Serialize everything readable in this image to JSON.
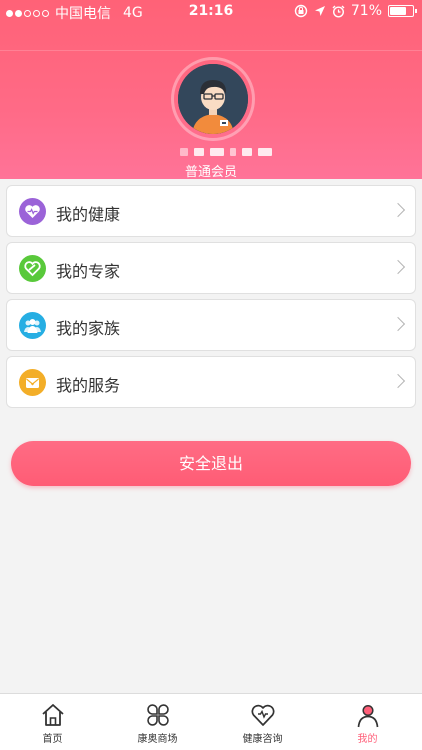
{
  "status_bar": {
    "carrier": "中国电信",
    "network": "4G",
    "time": "21:16",
    "battery_percent": "71%",
    "battery_level": 0.71,
    "signal_bars_filled": 2,
    "signal_bars_total": 5
  },
  "profile": {
    "member_level": "普通会员"
  },
  "menu": {
    "items": [
      {
        "label": "我的健康",
        "icon": "heart-pulse-icon",
        "color": "#9b63d8"
      },
      {
        "label": "我的专家",
        "icon": "expert-heart-icon",
        "color": "#59c93b"
      },
      {
        "label": "我的家族",
        "icon": "family-icon",
        "color": "#26aee3"
      },
      {
        "label": "我的服务",
        "icon": "service-envelope-icon",
        "color": "#f3ae28"
      }
    ]
  },
  "logout": {
    "label": "安全退出"
  },
  "tabbar": {
    "items": [
      {
        "label": "首页",
        "icon": "home-icon"
      },
      {
        "label": "康奥商场",
        "icon": "mall-clover-icon"
      },
      {
        "label": "健康咨询",
        "icon": "consult-heart-icon"
      },
      {
        "label": "我的",
        "icon": "profile-icon"
      }
    ],
    "active_index": 3,
    "active_color": "#ff5f79"
  },
  "colors": {
    "header_top": "#ff6277",
    "header_bottom": "#ff7398",
    "logout": "#ff6c84"
  }
}
